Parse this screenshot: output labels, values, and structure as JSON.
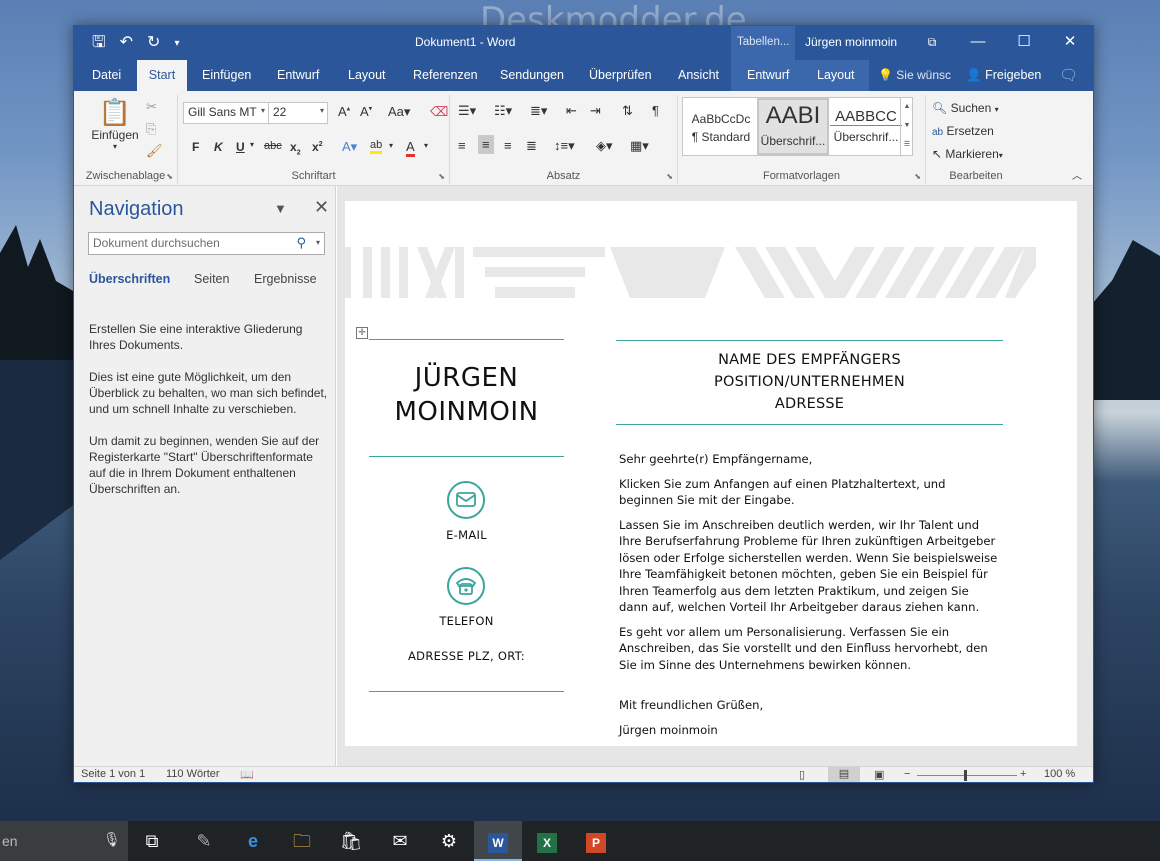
{
  "watermark": "Deskmodder.de",
  "titlebar": {
    "title": "Dokument1  -  Word",
    "context_title": "Tabellen...",
    "user": "Jürgen moinmoin"
  },
  "tabs": {
    "items": [
      "Datei",
      "Start",
      "Einfügen",
      "Entwurf",
      "Layout",
      "Referenzen",
      "Sendungen",
      "Überprüfen",
      "Ansicht",
      "Entwurf",
      "Layout"
    ],
    "active": "Start",
    "tell_me": "Sie wünsc",
    "share": "Freigeben"
  },
  "ribbon": {
    "clipboard": {
      "paste": "Einfügen",
      "label": "Zwischenablage"
    },
    "font": {
      "name": "Gill Sans MT",
      "size": "22",
      "label": "Schriftart"
    },
    "paragraph": {
      "label": "Absatz"
    },
    "styles": {
      "label": "Formatvorlagen",
      "items": [
        {
          "preview": "AaBbCcDc",
          "name": "¶ Standard"
        },
        {
          "preview": "AABI",
          "name": "Überschrif..."
        },
        {
          "preview": "AABBCC",
          "name": "Überschrif..."
        }
      ]
    },
    "editing": {
      "find": "Suchen",
      "replace": "Ersetzen",
      "select": "Markieren",
      "label": "Bearbeiten"
    }
  },
  "navigation": {
    "title": "Navigation",
    "search_placeholder": "Dokument durchsuchen",
    "tabs": [
      "Überschriften",
      "Seiten",
      "Ergebnisse"
    ],
    "text1": "Erstellen Sie eine interaktive Gliederung Ihres Dokuments.",
    "text2": "Dies ist eine gute Möglichkeit, um den Überblick zu behalten, wo man sich befindet, und um schnell Inhalte zu verschieben.",
    "text3": "Um damit zu beginnen, wenden Sie auf der Registerkarte \"Start\" Überschriftenformate auf die in Ihrem Dokument enthaltenen Überschriften an."
  },
  "document": {
    "name_line1": "JÜRGEN",
    "name_line2": "MOINMOIN",
    "email_label": "E-MAIL",
    "phone_label": "TELEFON",
    "address_label": "ADRESSE PLZ, ORT:",
    "recipient_line1": "NAME DES EMPFÄNGERS",
    "recipient_line2": "POSITION/UNTERNEHMEN",
    "recipient_line3": "ADRESSE",
    "salutation": "Sehr geehrte(r) Empfängername,",
    "para1": "Klicken Sie zum Anfangen auf einen Platzhaltertext, und beginnen Sie mit der Eingabe.",
    "para2": "Lassen Sie im Anschreiben deutlich werden, wir Ihr Talent und Ihre Berufserfahrung Probleme für Ihren zukünftigen Arbeitgeber lösen oder Erfolge sicherstellen werden. Wenn Sie beispielsweise Ihre Teamfähigkeit betonen möchten, geben Sie ein Beispiel für Ihren Teamerfolg aus dem letzten Praktikum, und zeigen Sie dann auf, welchen Vorteil Ihr Arbeitgeber daraus ziehen kann.",
    "para3": "Es geht vor allem um Personalisierung. Verfassen Sie ein Anschreiben, das Sie vorstellt und den Einfluss hervorhebt, den Sie im Sinne des Unternehmens bewirken können.",
    "closing": "Mit freundlichen Grüßen,",
    "signature": "Jürgen moinmoin"
  },
  "statusbar": {
    "page": "Seite 1 von 1",
    "words": "110 Wörter",
    "zoom": "100 %"
  },
  "taskbar": {
    "search_fragment": "en"
  },
  "colors": {
    "word_blue": "#2b579a",
    "accent_teal": "#3aa59a"
  }
}
